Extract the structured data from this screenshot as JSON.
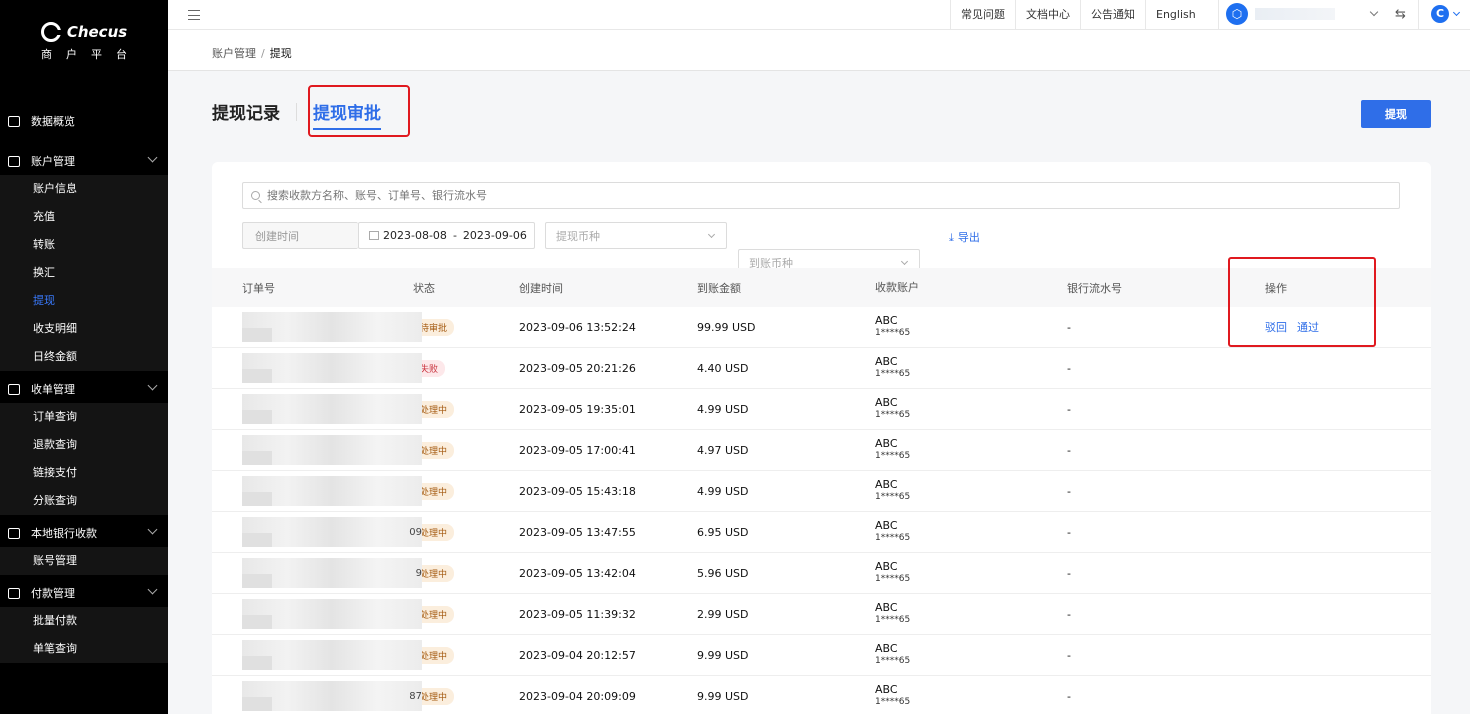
{
  "brand": {
    "name": "Checus",
    "subtitle": "商户平台"
  },
  "sidebar": {
    "groups": [
      {
        "label": "数据概览",
        "icon": "chart-icon",
        "items": []
      },
      {
        "label": "账户管理",
        "icon": "accounts-icon",
        "items": [
          "账户信息",
          "充值",
          "转账",
          "换汇",
          "提现",
          "收支明细",
          "日终金额"
        ]
      },
      {
        "label": "收单管理",
        "icon": "receipt-icon",
        "items": [
          "订单查询",
          "退款查询",
          "链接支付",
          "分账查询"
        ]
      },
      {
        "label": "本地银行收款",
        "icon": "bank-icon",
        "items": [
          "账号管理"
        ]
      },
      {
        "label": "付款管理",
        "icon": "payment-icon",
        "items": [
          "批量付款",
          "单笔查询"
        ]
      }
    ],
    "active": "提现"
  },
  "topbar": {
    "links": [
      "常见问题",
      "文档中心",
      "公告通知",
      "English"
    ],
    "user_initial": "C"
  },
  "breadcrumb": {
    "parent": "账户管理",
    "sep": "/",
    "current": "提现"
  },
  "tabs": {
    "records": "提现记录",
    "approval": "提现审批"
  },
  "actions": {
    "withdraw": "提现",
    "export": "导出"
  },
  "search": {
    "placeholder": "搜索收款方名称、账号、订单号、银行流水号"
  },
  "filters": {
    "created_label": "创建时间",
    "date_start": "2023-08-08",
    "date_sep": "-",
    "date_end": "2023-09-06",
    "withdraw_currency": "提现币种",
    "arrival_currency": "到账币种"
  },
  "table": {
    "headers": [
      "订单号",
      "状态",
      "创建时间",
      "到账金额",
      "收款账户",
      "银行流水号",
      "操作"
    ],
    "rows": [
      {
        "order_tail": "",
        "status": "待审批",
        "status_kind": "pending",
        "time": "2023-09-06 13:52:24",
        "amount": "99.99 USD",
        "acct_name": "ABC",
        "acct_num": "1****65",
        "ref": "-",
        "ops": [
          "驳回",
          "通过"
        ]
      },
      {
        "order_tail": "",
        "status": "失败",
        "status_kind": "fail",
        "time": "2023-09-05 20:21:26",
        "amount": "4.40 USD",
        "acct_name": "ABC",
        "acct_num": "1****65",
        "ref": "-",
        "ops": []
      },
      {
        "order_tail": "",
        "status": "处理中",
        "status_kind": "proc",
        "time": "2023-09-05 19:35:01",
        "amount": "4.99 USD",
        "acct_name": "ABC",
        "acct_num": "1****65",
        "ref": "-",
        "ops": []
      },
      {
        "order_tail": "",
        "status": "处理中",
        "status_kind": "proc",
        "time": "2023-09-05 17:00:41",
        "amount": "4.97 USD",
        "acct_name": "ABC",
        "acct_num": "1****65",
        "ref": "-",
        "ops": []
      },
      {
        "order_tail": "",
        "status": "处理中",
        "status_kind": "proc",
        "time": "2023-09-05 15:43:18",
        "amount": "4.99 USD",
        "acct_name": "ABC",
        "acct_num": "1****65",
        "ref": "-",
        "ops": []
      },
      {
        "order_tail": "09",
        "status": "处理中",
        "status_kind": "proc",
        "time": "2023-09-05 13:47:55",
        "amount": "6.95 USD",
        "acct_name": "ABC",
        "acct_num": "1****65",
        "ref": "-",
        "ops": []
      },
      {
        "order_tail": "9",
        "status": "处理中",
        "status_kind": "proc",
        "time": "2023-09-05 13:42:04",
        "amount": "5.96 USD",
        "acct_name": "ABC",
        "acct_num": "1****65",
        "ref": "-",
        "ops": []
      },
      {
        "order_tail": "",
        "status": "处理中",
        "status_kind": "proc",
        "time": "2023-09-05 11:39:32",
        "amount": "2.99 USD",
        "acct_name": "ABC",
        "acct_num": "1****65",
        "ref": "-",
        "ops": []
      },
      {
        "order_tail": "",
        "status": "处理中",
        "status_kind": "proc",
        "time": "2023-09-04 20:12:57",
        "amount": "9.99 USD",
        "acct_name": "ABC",
        "acct_num": "1****65",
        "ref": "-",
        "ops": []
      },
      {
        "order_tail": "87",
        "status": "处理中",
        "status_kind": "proc",
        "time": "2023-09-04 20:09:09",
        "amount": "9.99 USD",
        "acct_name": "ABC",
        "acct_num": "1****65",
        "ref": "-",
        "ops": []
      }
    ]
  },
  "colors": {
    "accent": "#2f6ee8",
    "highlight": "#e0191f",
    "sidebar_bg": "#000000"
  }
}
